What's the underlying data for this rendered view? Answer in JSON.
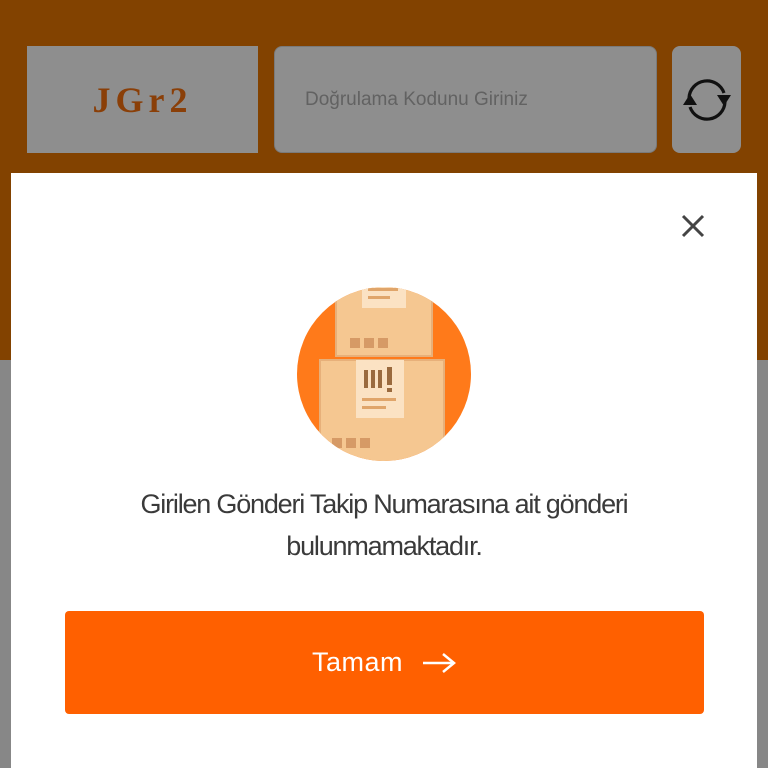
{
  "captcha": {
    "code": "JGr2",
    "input_placeholder": "Doğrulama Kodunu Giriniz",
    "refresh_icon": "refresh-icon"
  },
  "dialog": {
    "close_icon": "close-icon",
    "illustration": "package-boxes-icon",
    "message": "Girilen Gönderi Takip Numarasına ait gönderi bulunmamaktadır.",
    "ok_button_label": "Tamam",
    "ok_button_icon": "arrow-right-icon"
  },
  "colors": {
    "header_dimmed": "#824200",
    "accent": "#ff6000",
    "overlay_gray": "#878787"
  }
}
